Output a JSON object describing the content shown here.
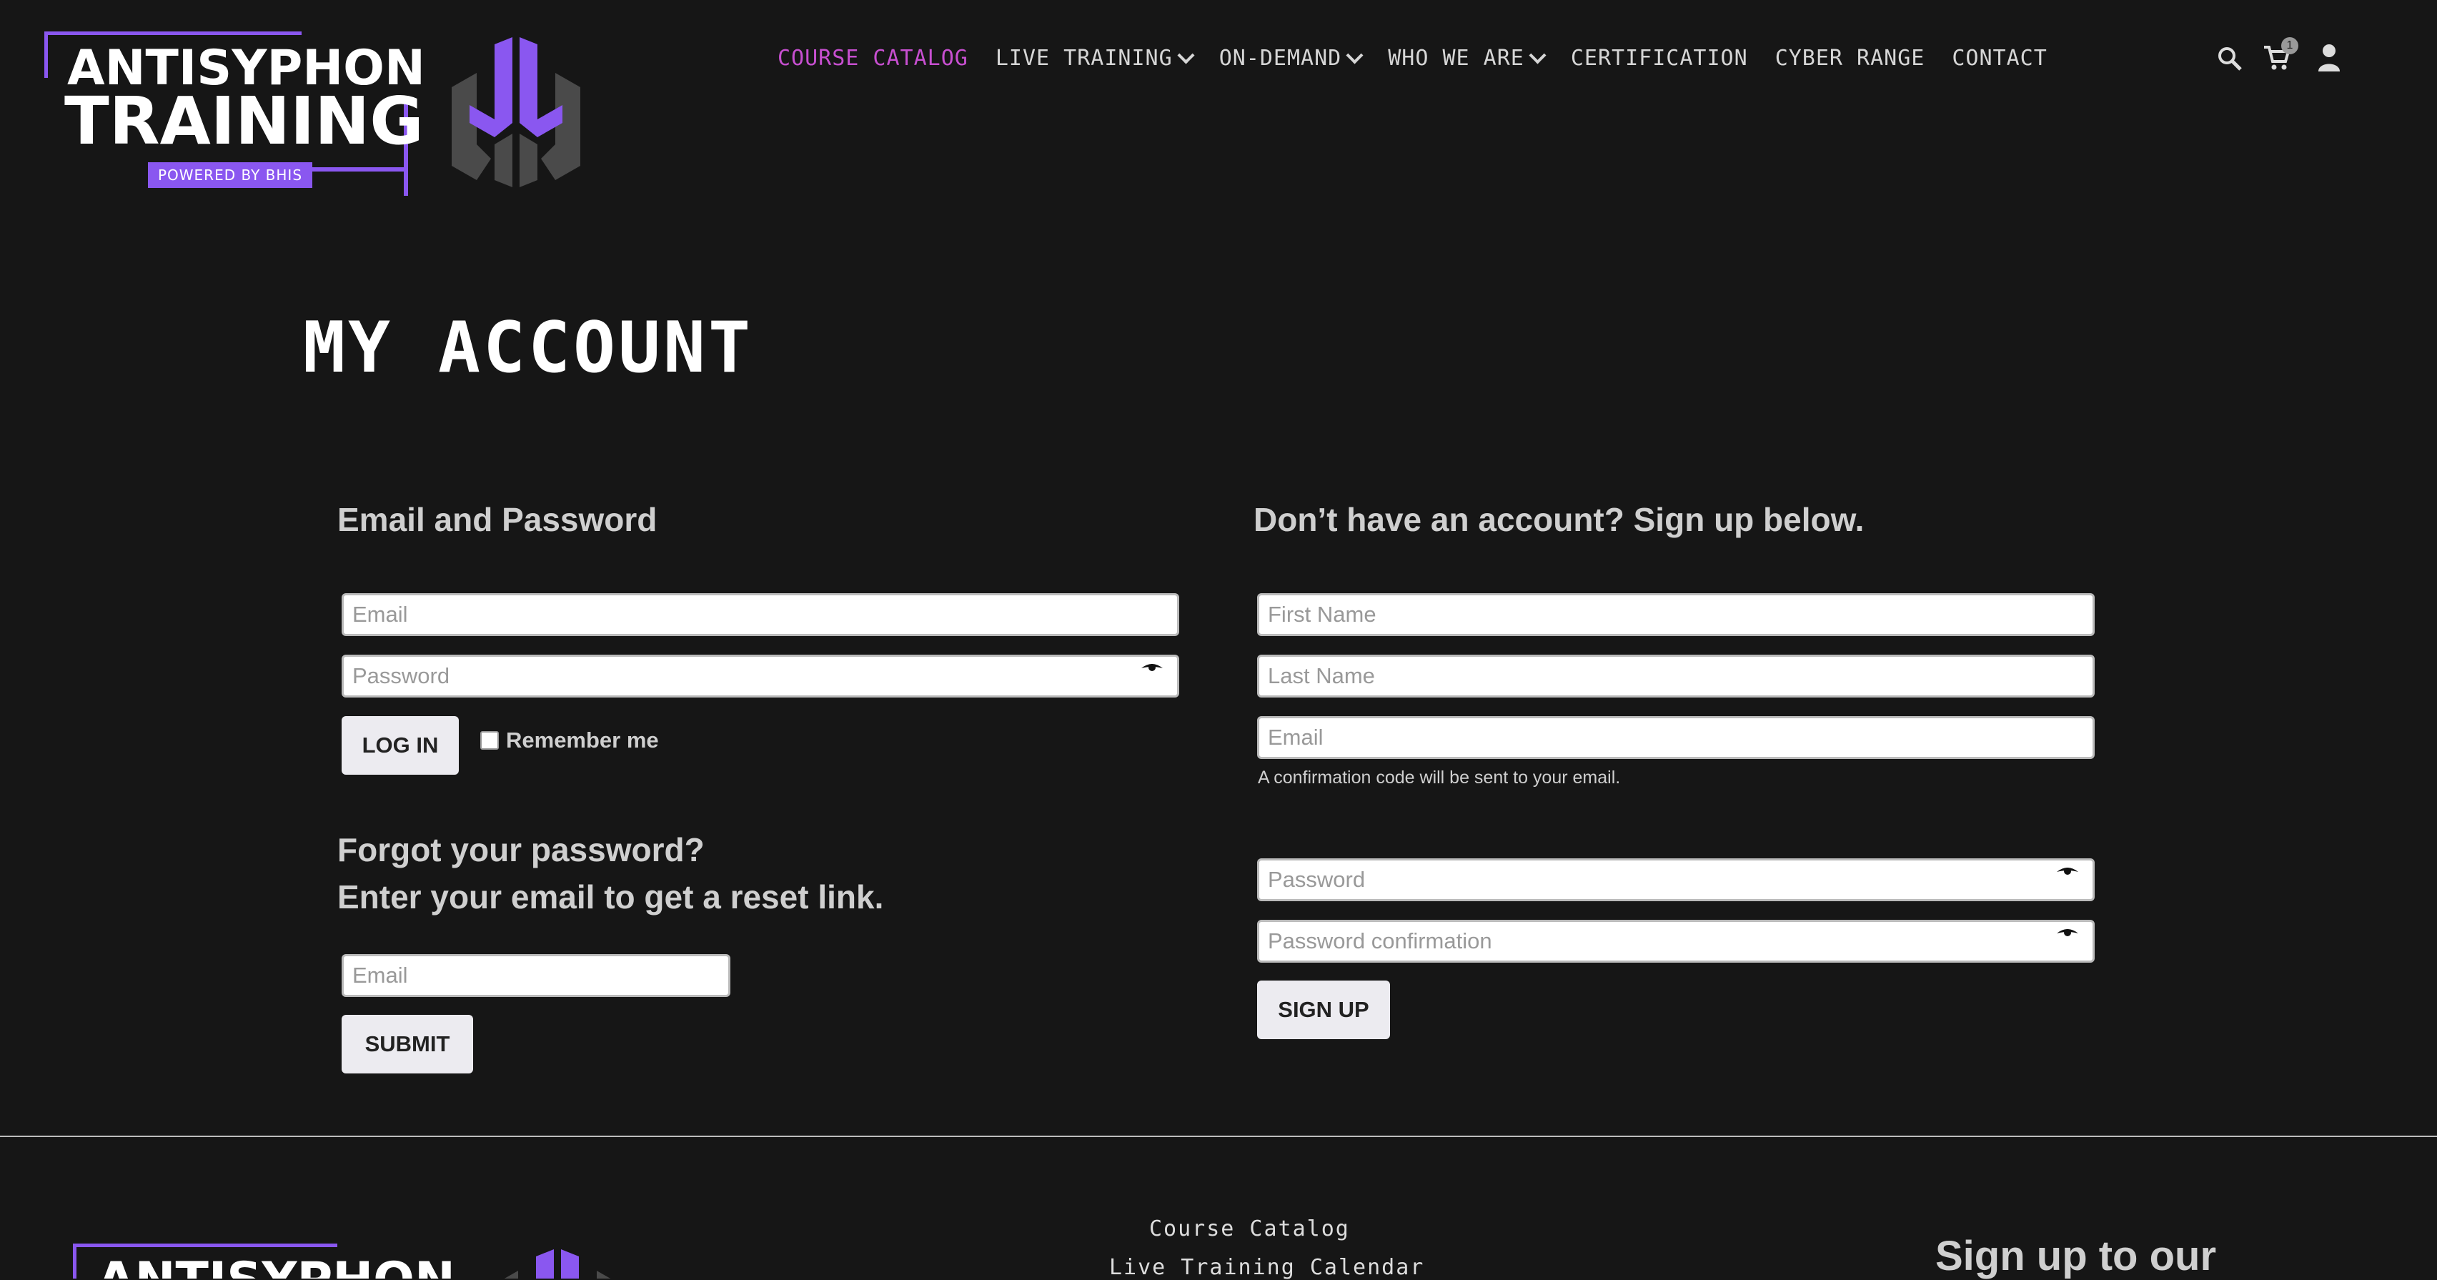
{
  "header": {
    "logo": {
      "line1": "ANTISYPHON",
      "line2": "TRAINING",
      "tag": "POWERED BY BHIS"
    },
    "nav": [
      {
        "label": "COURSE CATALOG",
        "active": true,
        "dropdown": false
      },
      {
        "label": "LIVE TRAINING",
        "active": false,
        "dropdown": true
      },
      {
        "label": "ON-DEMAND",
        "active": false,
        "dropdown": true
      },
      {
        "label": "WHO WE ARE",
        "active": false,
        "dropdown": true
      },
      {
        "label": "CERTIFICATION",
        "active": false,
        "dropdown": false
      },
      {
        "label": "CYBER RANGE",
        "active": false,
        "dropdown": false
      },
      {
        "label": "CONTACT",
        "active": false,
        "dropdown": false
      }
    ],
    "cart_count": "1",
    "icons": [
      "search-icon",
      "cart-icon",
      "user-icon"
    ]
  },
  "page": {
    "title": "MY ACCOUNT"
  },
  "login": {
    "heading": "Email and Password",
    "email_placeholder": "Email",
    "password_placeholder": "Password",
    "login_button": "LOG IN",
    "remember_label": "Remember me"
  },
  "forgot": {
    "heading_line1": "Forgot your password?",
    "heading_line2": "Enter your email to get a reset link.",
    "email_placeholder": "Email",
    "submit_button": "SUBMIT"
  },
  "signup": {
    "heading": "Don’t have an account? Sign up below.",
    "first_name_placeholder": "First Name",
    "last_name_placeholder": "Last Name",
    "email_placeholder": "Email",
    "email_hint": "A confirmation code will be sent to your email.",
    "password_placeholder": "Password",
    "password_confirm_placeholder": "Password confirmation",
    "signup_button": "SIGN UP"
  },
  "footer": {
    "links": [
      "Course Catalog",
      "Live Training Calendar"
    ],
    "signup_heading": "Sign up to our",
    "logo_line1": "ANTISYPHON"
  },
  "colors": {
    "background": "#161616",
    "accent_purple": "#8a57f0",
    "active_nav": "#c74fd0"
  }
}
